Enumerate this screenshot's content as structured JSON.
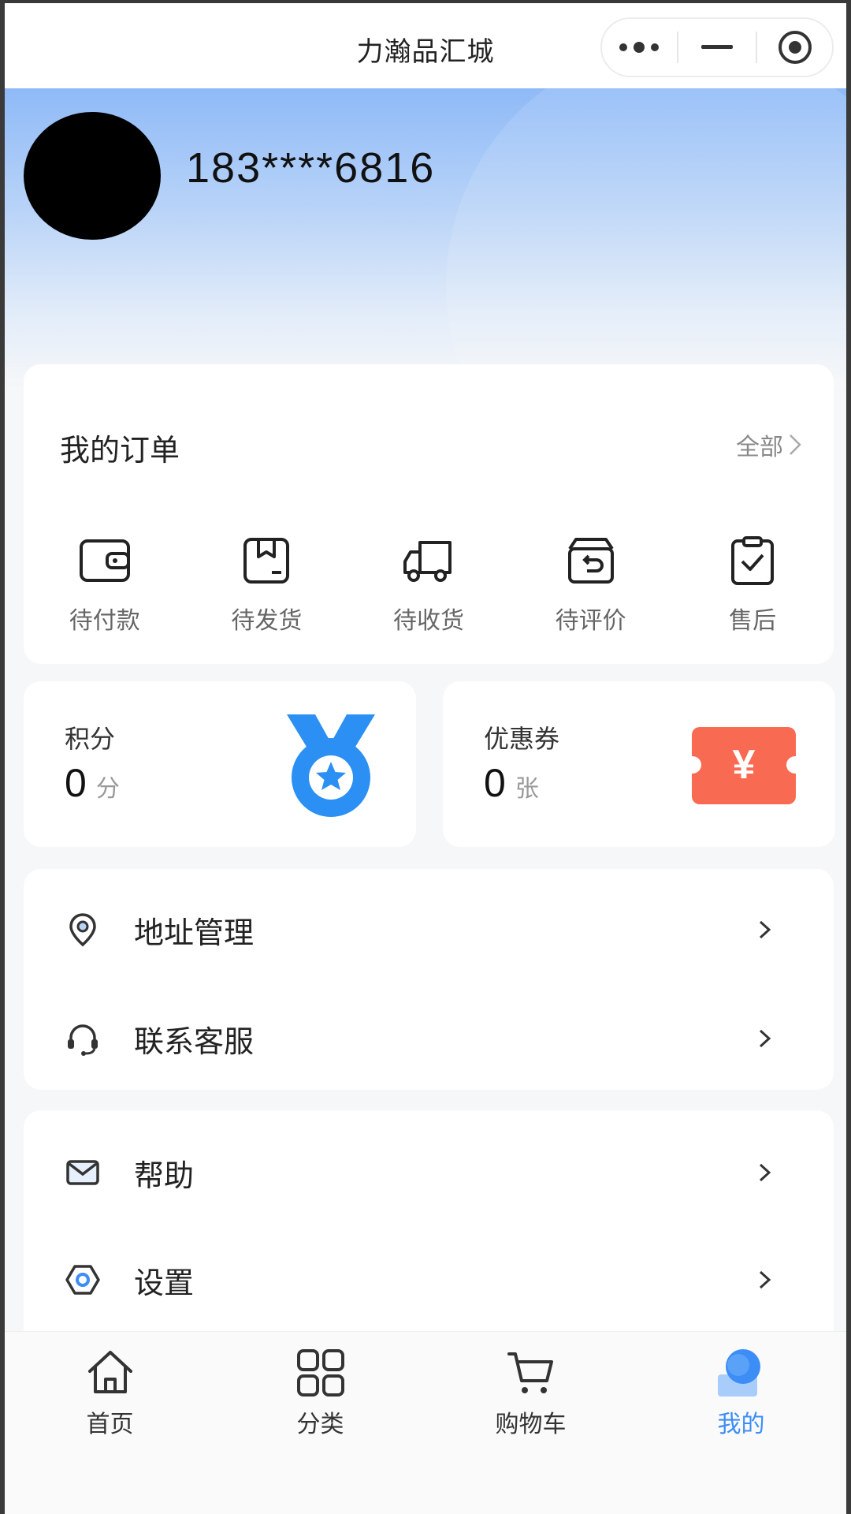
{
  "app": {
    "title": "力瀚品汇城"
  },
  "profile": {
    "phone": "183****6816"
  },
  "orders": {
    "title": "我的订单",
    "all_label": "全部",
    "items": [
      {
        "label": "待付款",
        "icon": "wallet-icon"
      },
      {
        "label": "待发货",
        "icon": "package-icon"
      },
      {
        "label": "待收货",
        "icon": "truck-icon"
      },
      {
        "label": "待评价",
        "icon": "review-box-icon"
      },
      {
        "label": "售后",
        "icon": "clipboard-check-icon"
      }
    ]
  },
  "points": {
    "title": "积分",
    "value": "0",
    "unit": "分",
    "icon": "medal-icon"
  },
  "coupons": {
    "title": "优惠券",
    "value": "0",
    "unit": "张",
    "icon": "coupon-icon",
    "icon_text": "¥"
  },
  "menu_group1": [
    {
      "label": "地址管理",
      "icon": "location-pin-icon"
    },
    {
      "label": "联系客服",
      "icon": "headset-icon"
    }
  ],
  "menu_group2": [
    {
      "label": "帮助",
      "icon": "mail-icon"
    },
    {
      "label": "设置",
      "icon": "settings-hex-icon"
    }
  ],
  "tabbar": [
    {
      "label": "首页",
      "icon": "home-icon",
      "active": false
    },
    {
      "label": "分类",
      "icon": "grid-icon",
      "active": false
    },
    {
      "label": "购物车",
      "icon": "cart-icon",
      "active": false
    },
    {
      "label": "我的",
      "icon": "profile-icon",
      "active": true
    }
  ],
  "colors": {
    "accent": "#3d8df6",
    "coupon": "#f86a52",
    "medal": "#2b8ff3"
  }
}
